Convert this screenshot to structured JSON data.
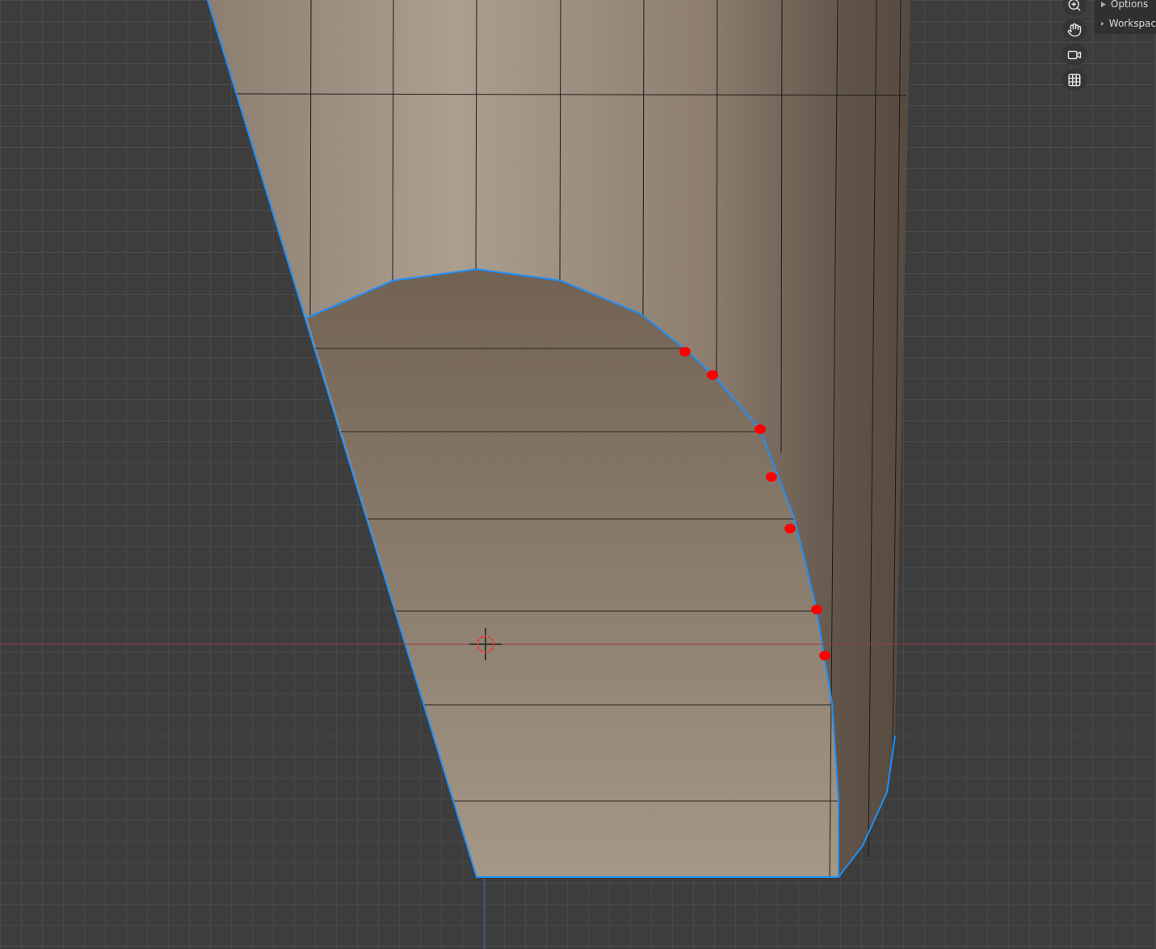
{
  "sidebar_panel": {
    "sections": [
      {
        "label": "Options",
        "expanded": false
      },
      {
        "label": "Workspac",
        "expanded": false
      }
    ]
  }
}
